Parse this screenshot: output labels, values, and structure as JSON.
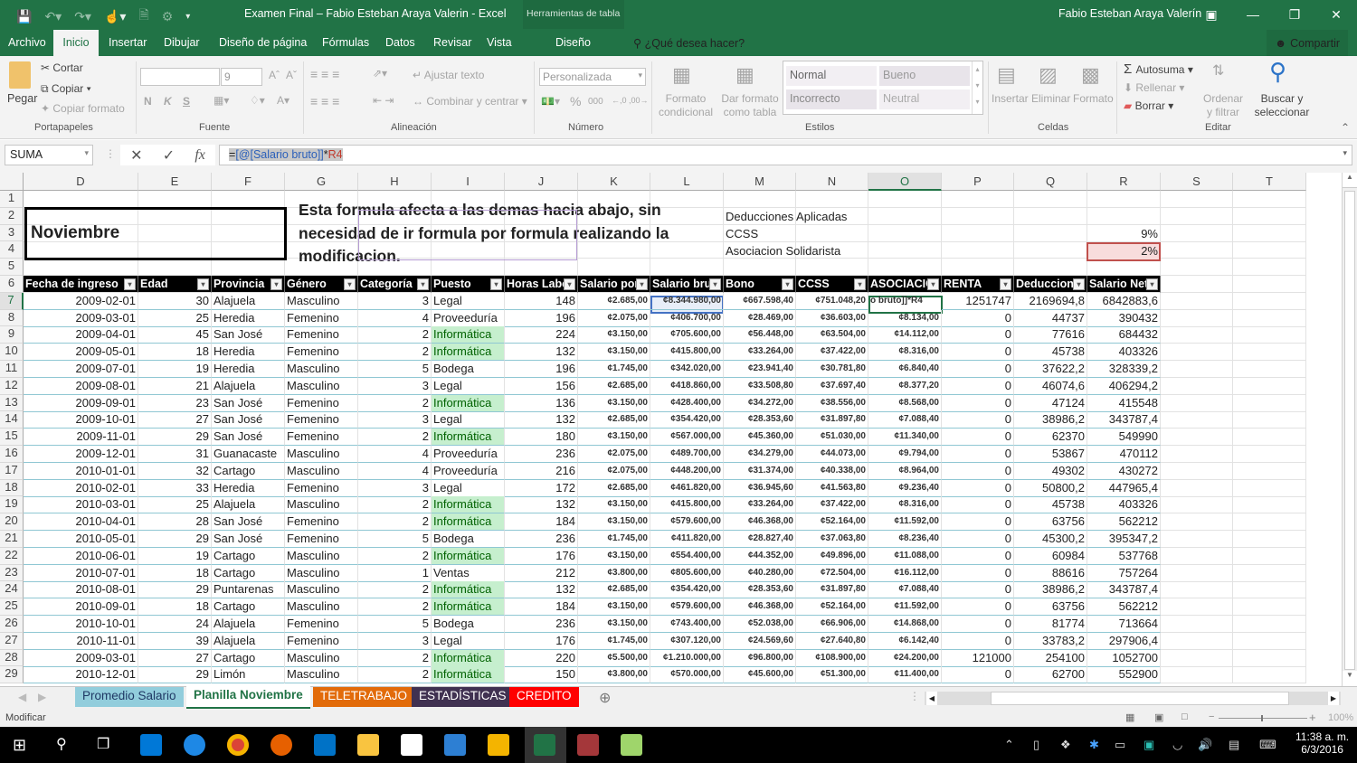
{
  "window": {
    "title": "Examen Final – Fabio Esteban Araya Valerin - Excel",
    "context_tab_group": "Herramientas de tabla",
    "user": "Fabio Esteban Araya Valerín"
  },
  "ribbon_tabs": [
    "Archivo",
    "Inicio",
    "Insertar",
    "Dibujar",
    "Diseño de página",
    "Fórmulas",
    "Datos",
    "Revisar",
    "Vista",
    "Diseño"
  ],
  "active_tab": "Inicio",
  "tell_me": "¿Qué desea hacer?",
  "share_label": "Compartir",
  "ribbon": {
    "portapapeles": {
      "label": "Portapapeles",
      "paste": "Pegar",
      "cut": "Cortar",
      "copy": "Copiar",
      "format_painter": "Copiar formato"
    },
    "fuente": {
      "label": "Fuente",
      "font_name": "",
      "font_size": "9",
      "bold": "N",
      "italic": "K",
      "underline": "S"
    },
    "alineacion": {
      "label": "Alineación",
      "wrap": "Ajustar texto",
      "merge": "Combinar y centrar"
    },
    "numero": {
      "label": "Número",
      "format": "Personalizada",
      "percent": "%",
      "thousands": "000"
    },
    "estilos": {
      "label": "Estilos",
      "cond_format": "Formato condicional",
      "table_format": "Dar formato como tabla",
      "styles": [
        "Normal",
        "Bueno",
        "Incorrecto",
        "Neutral"
      ]
    },
    "celdas": {
      "label": "Celdas",
      "insert": "Insertar",
      "delete": "Eliminar",
      "format": "Formato"
    },
    "editar": {
      "label": "Editar",
      "autosum": "Autosuma",
      "fill": "Rellenar",
      "clear": "Borrar",
      "sort": "Ordenar y filtrar",
      "find": "Buscar y seleccionar"
    }
  },
  "formula_bar": {
    "name_box": "SUMA",
    "formula_prefix": "=",
    "formula_ref": "[@[Salario bruto]]",
    "formula_op": "*",
    "formula_cell": "R4"
  },
  "columns": [
    "D",
    "E",
    "F",
    "G",
    "H",
    "I",
    "J",
    "K",
    "L",
    "M",
    "N",
    "O",
    "P",
    "Q",
    "R",
    "S",
    "T"
  ],
  "selected_column": "O",
  "rows": [
    "1",
    "2",
    "3",
    "4",
    "5",
    "6",
    "7",
    "8",
    "9",
    "10",
    "11",
    "12",
    "13",
    "14",
    "15",
    "16",
    "17",
    "18",
    "19",
    "20",
    "21",
    "22",
    "23",
    "24",
    "25",
    "26",
    "27",
    "28",
    "29"
  ],
  "selected_row": "7",
  "sheet": {
    "title_box": "Noviembre",
    "note": "Esta formula afecta a las demas hacia abajo, sin necesidad de ir formula por formula realizando la modificacion.",
    "deductions_title": "Deducciones Aplicadas",
    "ccss_label": "CCSS",
    "ccss_value": "9%",
    "asoc_label": "Asociacion Solidarista",
    "asoc_value": "2%"
  },
  "table": {
    "headers": [
      "Fecha de ingreso",
      "Edad",
      "Provincia",
      "Género",
      "Categoría",
      "Puesto",
      "Horas Labo",
      "Salario por",
      "Salario bru",
      "Bono",
      "CCSS",
      "ASOCIACIO",
      "RENTA",
      "Deduccion",
      "Salario Net"
    ],
    "rows": [
      [
        "2009-02-01",
        "30",
        "Alajuela",
        "Masculino",
        "3",
        "Legal",
        "148",
        "¢2.685,00",
        "¢8.344.980,00",
        "¢667.598,40",
        "¢751.048,20",
        "o bruto]]*R4",
        "1251747",
        "2169694,8",
        "6842883,6"
      ],
      [
        "2009-03-01",
        "25",
        "Heredia",
        "Femenino",
        "4",
        "Proveeduría",
        "196",
        "¢2.075,00",
        "¢406.700,00",
        "¢28.469,00",
        "¢36.603,00",
        "¢8.134,00",
        "0",
        "44737",
        "390432"
      ],
      [
        "2009-04-01",
        "45",
        "San José",
        "Femenino",
        "2",
        "Informática",
        "224",
        "¢3.150,00",
        "¢705.600,00",
        "¢56.448,00",
        "¢63.504,00",
        "¢14.112,00",
        "0",
        "77616",
        "684432"
      ],
      [
        "2009-05-01",
        "18",
        "Heredia",
        "Femenino",
        "2",
        "Informática",
        "132",
        "¢3.150,00",
        "¢415.800,00",
        "¢33.264,00",
        "¢37.422,00",
        "¢8.316,00",
        "0",
        "45738",
        "403326"
      ],
      [
        "2009-07-01",
        "19",
        "Heredia",
        "Masculino",
        "5",
        "Bodega",
        "196",
        "¢1.745,00",
        "¢342.020,00",
        "¢23.941,40",
        "¢30.781,80",
        "¢6.840,40",
        "0",
        "37622,2",
        "328339,2"
      ],
      [
        "2009-08-01",
        "21",
        "Alajuela",
        "Masculino",
        "3",
        "Legal",
        "156",
        "¢2.685,00",
        "¢418.860,00",
        "¢33.508,80",
        "¢37.697,40",
        "¢8.377,20",
        "0",
        "46074,6",
        "406294,2"
      ],
      [
        "2009-09-01",
        "23",
        "San José",
        "Femenino",
        "2",
        "Informática",
        "136",
        "¢3.150,00",
        "¢428.400,00",
        "¢34.272,00",
        "¢38.556,00",
        "¢8.568,00",
        "0",
        "47124",
        "415548"
      ],
      [
        "2009-10-01",
        "27",
        "San José",
        "Femenino",
        "3",
        "Legal",
        "132",
        "¢2.685,00",
        "¢354.420,00",
        "¢28.353,60",
        "¢31.897,80",
        "¢7.088,40",
        "0",
        "38986,2",
        "343787,4"
      ],
      [
        "2009-11-01",
        "29",
        "San José",
        "Femenino",
        "2",
        "Informática",
        "180",
        "¢3.150,00",
        "¢567.000,00",
        "¢45.360,00",
        "¢51.030,00",
        "¢11.340,00",
        "0",
        "62370",
        "549990"
      ],
      [
        "2009-12-01",
        "31",
        "Guanacaste",
        "Masculino",
        "4",
        "Proveeduría",
        "236",
        "¢2.075,00",
        "¢489.700,00",
        "¢34.279,00",
        "¢44.073,00",
        "¢9.794,00",
        "0",
        "53867",
        "470112"
      ],
      [
        "2010-01-01",
        "32",
        "Cartago",
        "Masculino",
        "4",
        "Proveeduría",
        "216",
        "¢2.075,00",
        "¢448.200,00",
        "¢31.374,00",
        "¢40.338,00",
        "¢8.964,00",
        "0",
        "49302",
        "430272"
      ],
      [
        "2010-02-01",
        "33",
        "Heredia",
        "Femenino",
        "3",
        "Legal",
        "172",
        "¢2.685,00",
        "¢461.820,00",
        "¢36.945,60",
        "¢41.563,80",
        "¢9.236,40",
        "0",
        "50800,2",
        "447965,4"
      ],
      [
        "2010-03-01",
        "25",
        "Alajuela",
        "Masculino",
        "2",
        "Informática",
        "132",
        "¢3.150,00",
        "¢415.800,00",
        "¢33.264,00",
        "¢37.422,00",
        "¢8.316,00",
        "0",
        "45738",
        "403326"
      ],
      [
        "2010-04-01",
        "28",
        "San José",
        "Femenino",
        "2",
        "Informática",
        "184",
        "¢3.150,00",
        "¢579.600,00",
        "¢46.368,00",
        "¢52.164,00",
        "¢11.592,00",
        "0",
        "63756",
        "562212"
      ],
      [
        "2010-05-01",
        "29",
        "San José",
        "Femenino",
        "5",
        "Bodega",
        "236",
        "¢1.745,00",
        "¢411.820,00",
        "¢28.827,40",
        "¢37.063,80",
        "¢8.236,40",
        "0",
        "45300,2",
        "395347,2"
      ],
      [
        "2010-06-01",
        "19",
        "Cartago",
        "Masculino",
        "2",
        "Informática",
        "176",
        "¢3.150,00",
        "¢554.400,00",
        "¢44.352,00",
        "¢49.896,00",
        "¢11.088,00",
        "0",
        "60984",
        "537768"
      ],
      [
        "2010-07-01",
        "18",
        "Cartago",
        "Masculino",
        "1",
        "Ventas",
        "212",
        "¢3.800,00",
        "¢805.600,00",
        "¢40.280,00",
        "¢72.504,00",
        "¢16.112,00",
        "0",
        "88616",
        "757264"
      ],
      [
        "2010-08-01",
        "29",
        "Puntarenas",
        "Masculino",
        "2",
        "Informática",
        "132",
        "¢2.685,00",
        "¢354.420,00",
        "¢28.353,60",
        "¢31.897,80",
        "¢7.088,40",
        "0",
        "38986,2",
        "343787,4"
      ],
      [
        "2010-09-01",
        "18",
        "Cartago",
        "Masculino",
        "2",
        "Informática",
        "184",
        "¢3.150,00",
        "¢579.600,00",
        "¢46.368,00",
        "¢52.164,00",
        "¢11.592,00",
        "0",
        "63756",
        "562212"
      ],
      [
        "2010-10-01",
        "24",
        "Alajuela",
        "Femenino",
        "5",
        "Bodega",
        "236",
        "¢3.150,00",
        "¢743.400,00",
        "¢52.038,00",
        "¢66.906,00",
        "¢14.868,00",
        "0",
        "81774",
        "713664"
      ],
      [
        "2010-11-01",
        "39",
        "Alajuela",
        "Femenino",
        "3",
        "Legal",
        "176",
        "¢1.745,00",
        "¢307.120,00",
        "¢24.569,60",
        "¢27.640,80",
        "¢6.142,40",
        "0",
        "33783,2",
        "297906,4"
      ],
      [
        "2009-03-01",
        "27",
        "Cartago",
        "Masculino",
        "2",
        "Informática",
        "220",
        "¢5.500,00",
        "¢1.210.000,00",
        "¢96.800,00",
        "¢108.900,00",
        "¢24.200,00",
        "121000",
        "254100",
        "1052700"
      ],
      [
        "2010-12-01",
        "29",
        "Limón",
        "Masculino",
        "2",
        "Informática",
        "150",
        "¢3.800,00",
        "¢570.000,00",
        "¢45.600,00",
        "¢51.300,00",
        "¢11.400,00",
        "0",
        "62700",
        "552900"
      ]
    ]
  },
  "sheet_tabs": [
    {
      "label": "Promedio Salario",
      "color": "#92cddc",
      "text": "#1f3864"
    },
    {
      "label": "Planilla Noviembre",
      "color": "#ffffff",
      "text": "#217346",
      "active": true
    },
    {
      "label": "TELETRABAJO",
      "color": "#e26b0a",
      "text": "#ffffff"
    },
    {
      "label": "ESTADÍSTICAS",
      "color": "#403151",
      "text": "#ffffff"
    },
    {
      "label": "CREDITO",
      "color": "#ff0000",
      "text": "#ffffff"
    }
  ],
  "status": {
    "mode": "Modificar",
    "zoom": "100%"
  },
  "clock": {
    "time": "11:38 a. m.",
    "date": "6/3/2016"
  }
}
